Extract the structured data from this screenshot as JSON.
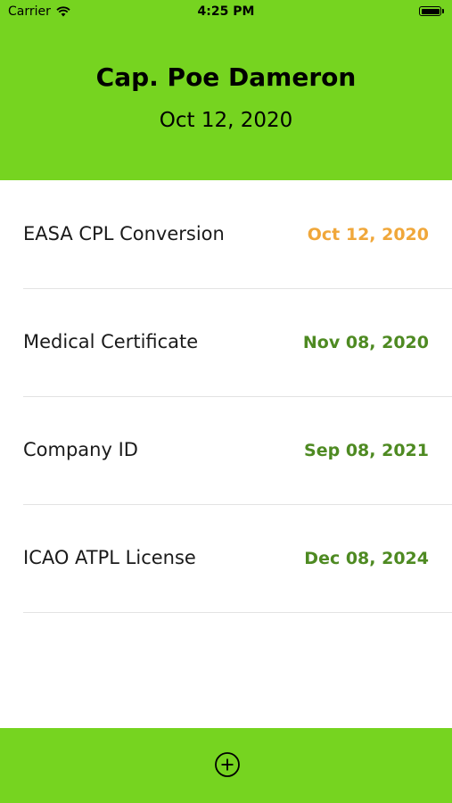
{
  "status_bar": {
    "carrier": "Carrier",
    "time": "4:25 PM"
  },
  "header": {
    "title": "Cap. Poe Dameron",
    "date": "Oct 12,  2020"
  },
  "colors": {
    "brand_green": "#76d420",
    "warning_orange": "#f0a73a",
    "ok_green": "#4e8a22"
  },
  "documents": [
    {
      "name": "EASA CPL Conversion",
      "date": "Oct 12,  2020",
      "status_color": "#f0a73a"
    },
    {
      "name": "Medical Certificate",
      "date": "Nov 08,  2020",
      "status_color": "#4e8a22"
    },
    {
      "name": "Company ID",
      "date": "Sep 08,  2021",
      "status_color": "#4e8a22"
    },
    {
      "name": "ICAO ATPL License",
      "date": "Dec 08,  2024",
      "status_color": "#4e8a22"
    }
  ],
  "footer": {
    "add_icon": "plus-circle-icon"
  }
}
